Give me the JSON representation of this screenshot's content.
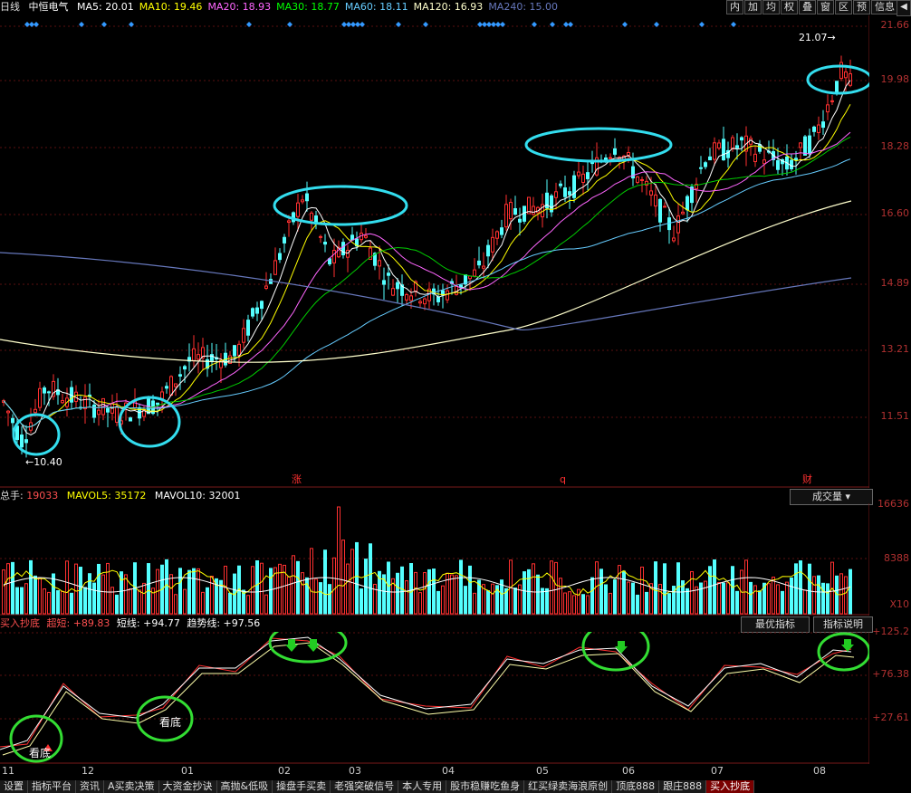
{
  "header": {
    "mode": "日线",
    "stock": "中恒电气",
    "ma": [
      {
        "label": "MA5: 20.01",
        "color": "#ffffff"
      },
      {
        "label": "MA10: 19.46",
        "color": "#ffff00"
      },
      {
        "label": "MA20: 18.93",
        "color": "#ff66ff"
      },
      {
        "label": "MA30: 18.77",
        "color": "#00ff00"
      },
      {
        "label": "MA60: 18.11",
        "color": "#66ccff"
      },
      {
        "label": "MA120: 16.93",
        "color": "#ffffcc"
      },
      {
        "label": "MA240: 15.00",
        "color": "#6677bb"
      }
    ]
  },
  "toolbar": [
    "内",
    "加",
    "均",
    "权",
    "叠",
    "窗",
    "区",
    "预",
    "信息"
  ],
  "price_axis": [
    "21.66",
    "19.98",
    "18.28",
    "16.60",
    "14.89",
    "13.21",
    "11.51"
  ],
  "annotations": {
    "high": "21.07",
    "low": "10.40",
    "events": [
      "涨",
      "q",
      "财"
    ]
  },
  "volume": {
    "title": "总手: ",
    "value": "19033",
    "ma5": "MAVOL5: 35172",
    "ma10": "MAVOL10: 32001",
    "selector": "成交量",
    "axis": [
      "16636",
      "8388"
    ],
    "unit": "X10"
  },
  "indicator": {
    "name": "买入抄底",
    "super": "超短: +89.83",
    "short": "短线: +94.77",
    "trend": "趋势线: +97.56",
    "buttons": [
      "最优指标",
      "指标说明"
    ],
    "axis": [
      "+125.2",
      "+76.38",
      "+27.61"
    ],
    "marks": [
      "看底",
      "看底"
    ]
  },
  "x_axis": [
    "11",
    "12",
    "01",
    "02",
    "03",
    "04",
    "05",
    "06",
    "07",
    "08"
  ],
  "bottom_tabs": [
    "设置",
    "指标平台",
    "资讯",
    "A买卖决策",
    "大资金抄诀",
    "高抛&低吸",
    "操盘手买卖",
    "老强突破信号",
    "本人专用",
    "股市稳赚吃鱼身",
    "红买绿卖海浪原创",
    "顶底888",
    "跟庄888",
    "买入抄底"
  ],
  "active_tab": "买入抄底"
}
